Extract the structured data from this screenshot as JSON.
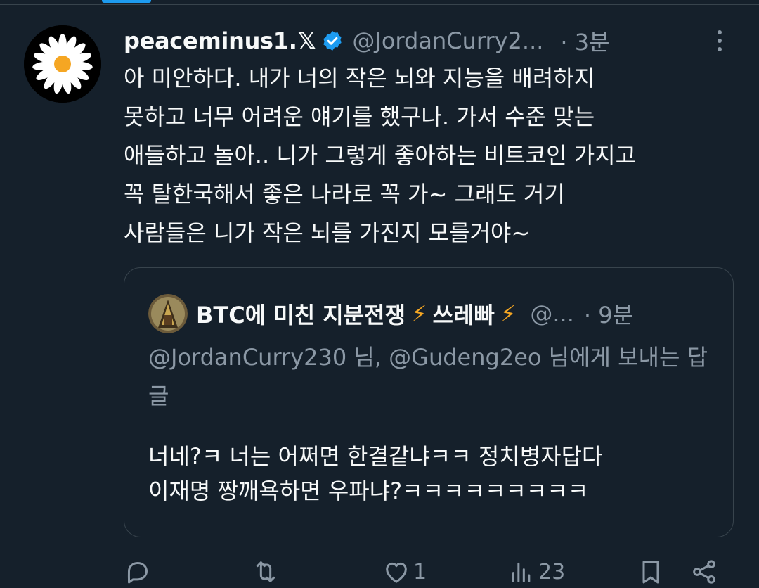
{
  "tweet": {
    "display_name": "peaceminus1.",
    "x_mark": "𝕏",
    "handle": "@JordanCurry2...",
    "time": "· 3분",
    "text": "아 미안하다. 내가 너의 작은 뇌와 지능을 배려하지\n못하고 너무 어려운 얘기를 했구나. 가서 수준 맞는\n애들하고 놀아.. 니가 그렇게 좋아하는 비트코인 가지고\n꼭 탈한국해서 좋은 나라로 꼭 가~ 그래도 거기\n사람들은 니가 작은 뇌를 가진지 모를거야~"
  },
  "quote": {
    "display_name": "BTC에 미친 지분전쟁",
    "lightning_1": "⚡",
    "name_suffix": "쓰레빠",
    "lightning_2": "⚡",
    "handle": "@...",
    "time": "· 9분",
    "replying_to": "@JordanCurry230 님, @Gudeng2eo 님에게 보내는 답글",
    "text": "너네?ㅋ 너는 어쩌면 한결같냐ㅋㅋ 정치병자답다\n이재명 짱깨욕하면 우파냐?ㅋㅋㅋㅋㅋㅋㅋㅋㅋ"
  },
  "actions": {
    "reply_count": "",
    "retweet_count": "",
    "like_count": "1",
    "view_count": "23"
  },
  "colors": {
    "background": "#15202b",
    "text_primary": "#f7f9f9",
    "text_secondary": "#8b98a5",
    "border": "#38444d",
    "verified_blue": "#1d9bf0",
    "lightning": "#f4a623"
  },
  "icons": [
    "more-icon",
    "verified-badge-icon",
    "reply-icon",
    "retweet-icon",
    "like-icon",
    "views-icon",
    "bookmark-icon",
    "share-icon",
    "lightning-icon"
  ]
}
